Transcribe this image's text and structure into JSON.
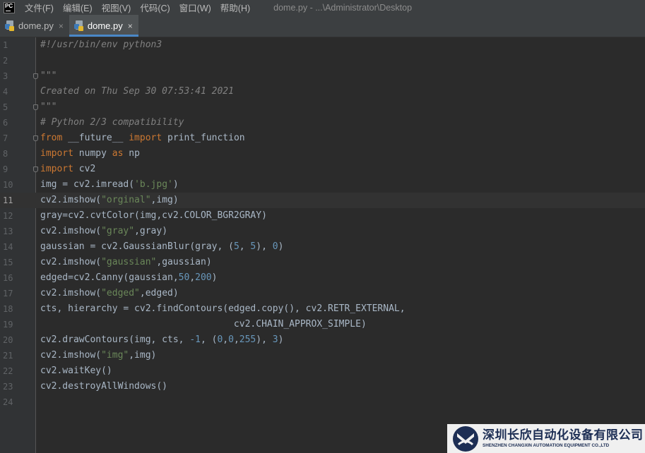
{
  "app": {
    "logo_text": "PC"
  },
  "menu": [
    "文件(F)",
    "编辑(E)",
    "视图(V)",
    "代码(C)",
    "窗口(W)",
    "帮助(H)"
  ],
  "window_title": "dome.py - ...\\Administrator\\Desktop",
  "tabs": [
    {
      "label": "dome.py",
      "close": "×",
      "active": false
    },
    {
      "label": "dome.py",
      "close": "×",
      "active": true
    }
  ],
  "current_line": 11,
  "lines": [
    {
      "n": "1",
      "fold": false,
      "tokens": [
        [
          "cmt",
          "#!/usr/bin/env python3"
        ]
      ]
    },
    {
      "n": "2",
      "fold": false,
      "tokens": []
    },
    {
      "n": "3",
      "fold": true,
      "tokens": [
        [
          "cmt",
          "\"\"\""
        ]
      ]
    },
    {
      "n": "4",
      "fold": false,
      "tokens": [
        [
          "cmt",
          "Created on Thu Sep 30 07:53:41 2021"
        ]
      ]
    },
    {
      "n": "5",
      "fold": true,
      "tokens": [
        [
          "cmt",
          "\"\"\""
        ]
      ]
    },
    {
      "n": "6",
      "fold": false,
      "tokens": [
        [
          "cmt",
          "# Python 2/3 compatibility"
        ]
      ]
    },
    {
      "n": "7",
      "fold": true,
      "tokens": [
        [
          "kw",
          "from "
        ],
        [
          "plain",
          "__future__ "
        ],
        [
          "kw",
          "import "
        ],
        [
          "plain",
          "print_function"
        ]
      ]
    },
    {
      "n": "8",
      "fold": false,
      "tokens": [
        [
          "kw",
          "import "
        ],
        [
          "plain",
          "numpy "
        ],
        [
          "kw",
          "as "
        ],
        [
          "plain",
          "np"
        ]
      ]
    },
    {
      "n": "9",
      "fold": true,
      "tokens": [
        [
          "kw",
          "import "
        ],
        [
          "plain",
          "cv2"
        ]
      ]
    },
    {
      "n": "10",
      "fold": false,
      "tokens": [
        [
          "plain",
          "img = cv2.imread("
        ],
        [
          "str",
          "'b.jpg'"
        ],
        [
          "plain",
          ")"
        ]
      ]
    },
    {
      "n": "11",
      "fold": false,
      "tokens": [
        [
          "plain",
          "cv2.imshow("
        ],
        [
          "str",
          "\"orginal\""
        ],
        [
          "plain",
          ",img)"
        ]
      ]
    },
    {
      "n": "12",
      "fold": false,
      "tokens": [
        [
          "plain",
          "gray=cv2.cvtColor(img,cv2.COLOR_BGR2GRAY)"
        ]
      ]
    },
    {
      "n": "13",
      "fold": false,
      "tokens": [
        [
          "plain",
          "cv2.imshow("
        ],
        [
          "str",
          "\"gray\""
        ],
        [
          "plain",
          ",gray)"
        ]
      ]
    },
    {
      "n": "14",
      "fold": false,
      "tokens": [
        [
          "plain",
          "gaussian = cv2.GaussianBlur(gray, ("
        ],
        [
          "num",
          "5"
        ],
        [
          "plain",
          ", "
        ],
        [
          "num",
          "5"
        ],
        [
          "plain",
          "), "
        ],
        [
          "num",
          "0"
        ],
        [
          "plain",
          ")"
        ]
      ]
    },
    {
      "n": "15",
      "fold": false,
      "tokens": [
        [
          "plain",
          "cv2.imshow("
        ],
        [
          "str",
          "\"gaussian\""
        ],
        [
          "plain",
          ",gaussian)"
        ]
      ]
    },
    {
      "n": "16",
      "fold": false,
      "tokens": [
        [
          "plain",
          "edged=cv2.Canny(gaussian,"
        ],
        [
          "num",
          "50"
        ],
        [
          "plain",
          ","
        ],
        [
          "num",
          "200"
        ],
        [
          "plain",
          ")"
        ]
      ]
    },
    {
      "n": "17",
      "fold": false,
      "tokens": [
        [
          "plain",
          "cv2.imshow("
        ],
        [
          "str",
          "\"edged\""
        ],
        [
          "plain",
          ",edged)"
        ]
      ]
    },
    {
      "n": "18",
      "fold": false,
      "tokens": [
        [
          "plain",
          "cts, hierarchy = cv2.findContours(edged.copy(), cv2.RETR_EXTERNAL,"
        ]
      ]
    },
    {
      "n": "19",
      "fold": false,
      "tokens": [
        [
          "plain",
          "                                   cv2.CHAIN_APPROX_SIMPLE)"
        ]
      ]
    },
    {
      "n": "20",
      "fold": false,
      "tokens": [
        [
          "plain",
          "cv2.drawContours(img, cts, "
        ],
        [
          "num",
          "-1"
        ],
        [
          "plain",
          ", ("
        ],
        [
          "num",
          "0"
        ],
        [
          "plain",
          ","
        ],
        [
          "num",
          "0"
        ],
        [
          "plain",
          ","
        ],
        [
          "num",
          "255"
        ],
        [
          "plain",
          "), "
        ],
        [
          "num",
          "3"
        ],
        [
          "plain",
          ")"
        ]
      ]
    },
    {
      "n": "21",
      "fold": false,
      "tokens": [
        [
          "plain",
          "cv2.imshow("
        ],
        [
          "str",
          "\"img\""
        ],
        [
          "plain",
          ",img)"
        ]
      ]
    },
    {
      "n": "22",
      "fold": false,
      "tokens": [
        [
          "plain",
          "cv2.waitKey()"
        ]
      ]
    },
    {
      "n": "23",
      "fold": false,
      "tokens": [
        [
          "plain",
          "cv2.destroyAllWindows()"
        ]
      ]
    },
    {
      "n": "24",
      "fold": false,
      "tokens": []
    }
  ],
  "watermark": {
    "name_cn": "深圳长欣自动化设备有限公司",
    "name_en": "SHENZHEN CHANGXIN AUTOMATION EQUIPMENT CO.,LTD"
  },
  "colors": {
    "keyword": "#cc7832",
    "string": "#6a8759",
    "number": "#6897bb",
    "comment": "#808080",
    "text": "#a9b7c6",
    "background": "#2b2b2b",
    "gutter": "#313335",
    "tab_underline": "#4a88c7"
  },
  "icons": [
    "python-file-icon",
    "close-icon",
    "fold-marker-icon",
    "pycharm-logo-icon",
    "company-logo-icon"
  ]
}
